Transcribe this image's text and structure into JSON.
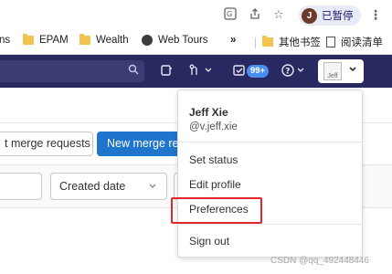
{
  "browser": {
    "profile_initial": "J",
    "profile_status": "已暂停"
  },
  "bookmarks": {
    "items": [
      {
        "label": "ns",
        "icon": "folder-icon"
      },
      {
        "label": "EPAM",
        "icon": "folder-icon"
      },
      {
        "label": "Wealth",
        "icon": "folder-icon"
      },
      {
        "label": "Web Tours",
        "icon": "globe-icon"
      }
    ],
    "overflow": "»",
    "other": "其他书签",
    "reading": "阅读清单"
  },
  "header": {
    "todo_count": "99+",
    "avatar_alt": "Jeff"
  },
  "page": {
    "view_button": "t merge requests",
    "new_button": "New merge req",
    "sort_value": "Created date"
  },
  "user_menu": {
    "name": "Jeff Xie",
    "handle": "@v.jeff.xie",
    "items": {
      "set_status": "Set status",
      "edit_profile": "Edit profile",
      "preferences": "Preferences",
      "sign_out": "Sign out"
    }
  },
  "watermark": "CSDN @qq_492448446",
  "colors": {
    "header_bg": "#292961",
    "primary": "#1f75cb",
    "highlight": "#e3262b"
  }
}
